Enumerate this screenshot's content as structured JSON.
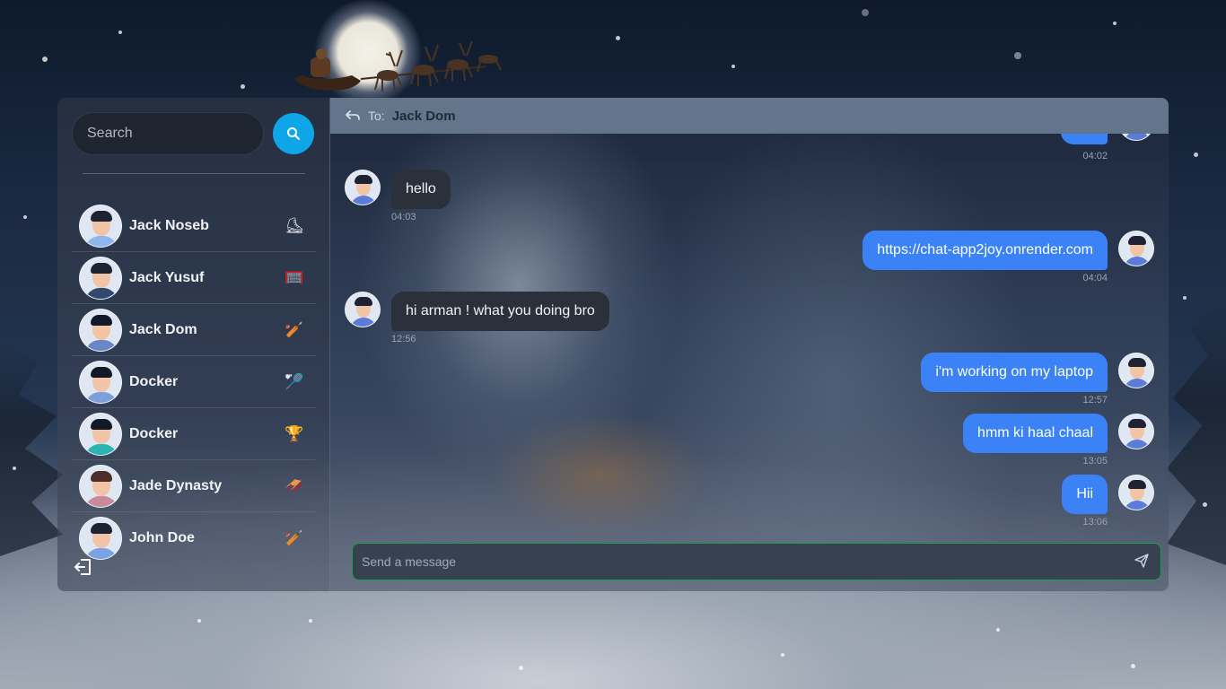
{
  "search": {
    "placeholder": "Search"
  },
  "conversations": [
    {
      "name": "Jack Noseb",
      "emoji": "⛸",
      "emoji_color": "#e5e7eb",
      "hair": "#1e2233",
      "shirt": "#8fb6ee"
    },
    {
      "name": "Jack Yusuf",
      "emoji": "🥅",
      "emoji_color": "#ef4444",
      "hair": "#1e2233",
      "shirt": "#2f4a6e"
    },
    {
      "name": "Jack Dom",
      "emoji": "🏏",
      "emoji_color": "#f97316",
      "hair": "#111827",
      "shirt": "#6b86c7"
    },
    {
      "name": "Docker",
      "emoji": "🏸",
      "emoji_color": "#60a5fa",
      "hair": "#111827",
      "shirt": "#7da0da"
    },
    {
      "name": "Docker",
      "emoji": "🏆",
      "emoji_color": "#f59e0b",
      "hair": "#111827",
      "shirt": "#2bb4b4"
    },
    {
      "name": "Jade Dynasty",
      "emoji": "🛷",
      "emoji_color": "#38bdf8",
      "hair": "#4b2e2a",
      "shirt": "#c88a9a"
    },
    {
      "name": "John Doe",
      "emoji": "🏏",
      "emoji_color": "#f97316",
      "hair": "#1e2233",
      "shirt": "#7aa3e3"
    }
  ],
  "header": {
    "to_label": "To:",
    "to_name": "Jack Dom"
  },
  "messages": [
    {
      "dir": "out",
      "text": "",
      "time": "04:02"
    },
    {
      "dir": "in",
      "text": "hello",
      "time": "04:03"
    },
    {
      "dir": "out",
      "text": "https://chat-app2joy.onrender.com",
      "time": "04:04"
    },
    {
      "dir": "in",
      "text": "hi arman ! what you doing bro",
      "time": "12:56"
    },
    {
      "dir": "out",
      "text": "i'm working on my laptop",
      "time": "12:57"
    },
    {
      "dir": "out",
      "text": "hmm ki haal chaal",
      "time": "13:05"
    },
    {
      "dir": "out",
      "text": "Hii",
      "time": "13:06"
    }
  ],
  "composer": {
    "placeholder": "Send a message"
  },
  "colors": {
    "accent": "#0ea5e9",
    "outgoing": "#3b82f6",
    "incoming": "#2b313b",
    "composer_border": "#16a34a"
  }
}
